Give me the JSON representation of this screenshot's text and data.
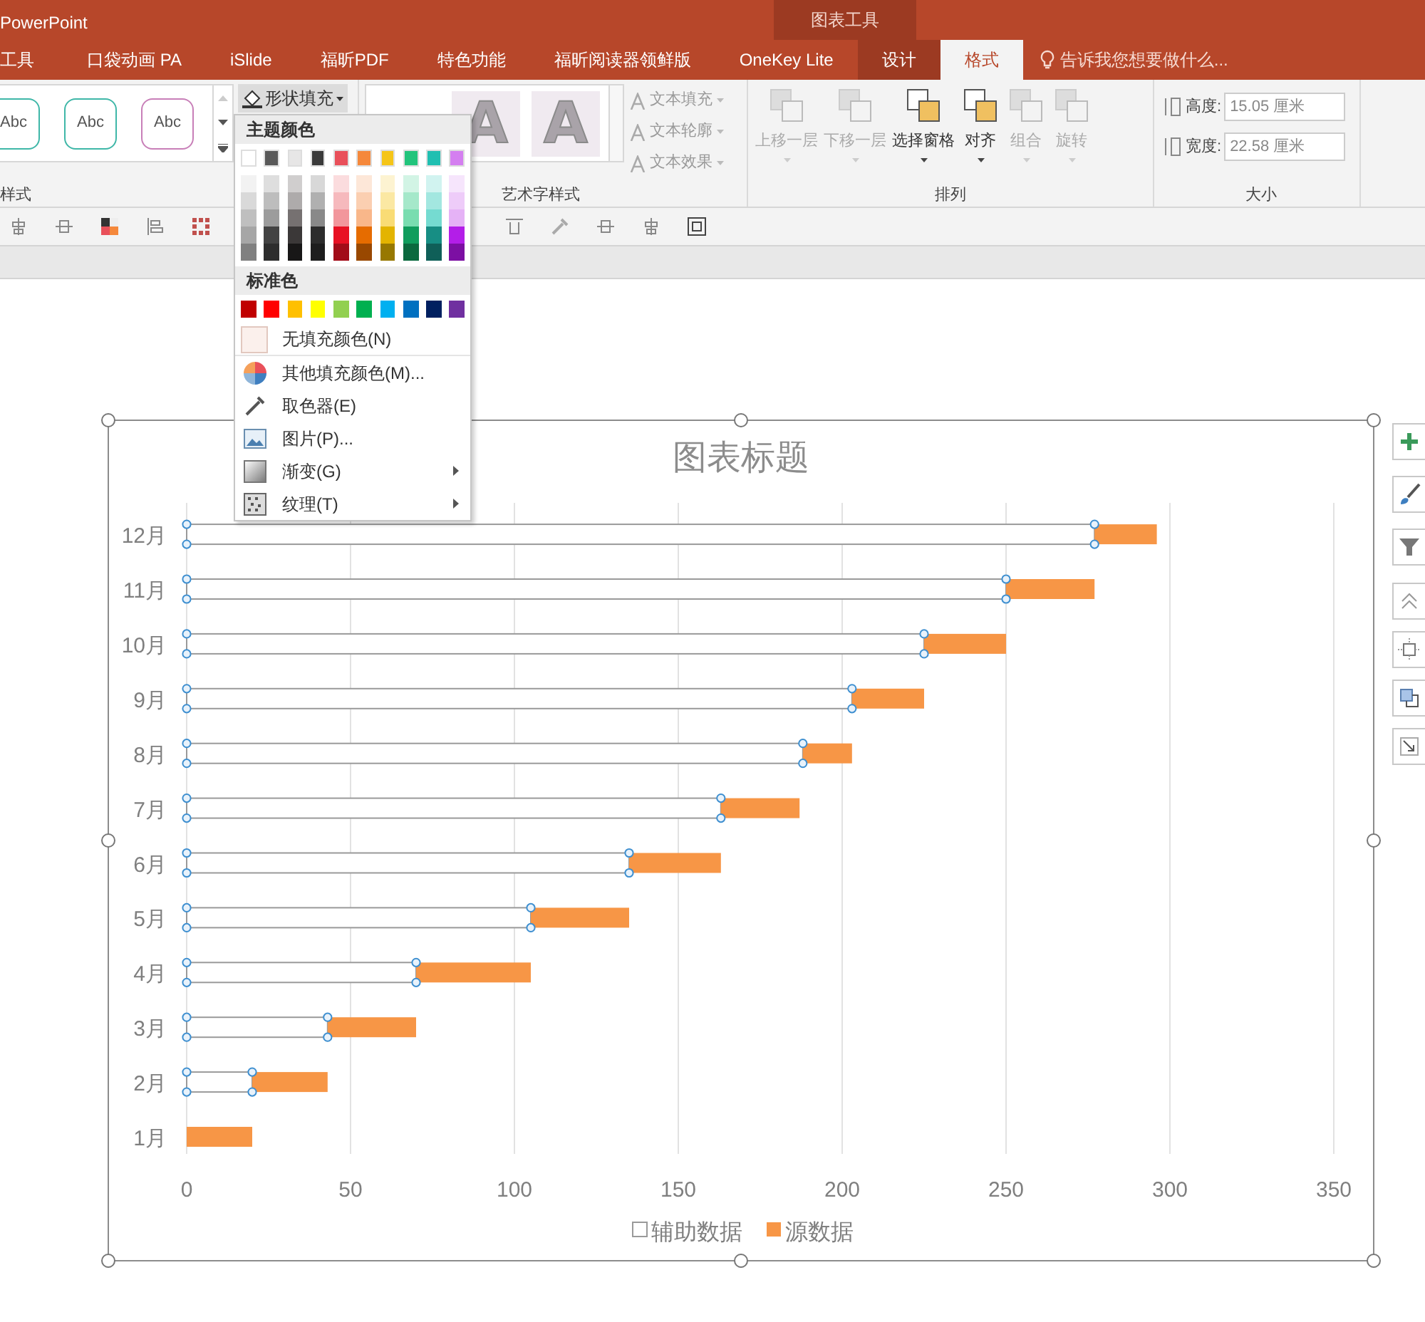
{
  "app_title": "PowerPoint",
  "context_tab_group": "图表工具",
  "tabs": [
    {
      "label": "工具",
      "selected": false
    },
    {
      "label": "口袋动画 PA",
      "selected": false
    },
    {
      "label": "iSlide",
      "selected": false
    },
    {
      "label": "福昕PDF",
      "selected": false
    },
    {
      "label": "特色功能",
      "selected": false
    },
    {
      "label": "福昕阅读器领鲜版",
      "selected": false
    },
    {
      "label": "OneKey Lite",
      "selected": false
    },
    {
      "label": "设计",
      "selected": false,
      "context": true
    },
    {
      "label": "格式",
      "selected": true,
      "context": true
    }
  ],
  "tell_me": {
    "placeholder": "告诉我您想要做什么..."
  },
  "ribbon": {
    "shape_styles": {
      "label": "样式",
      "samples": [
        {
          "text": "Abc",
          "color": "#3fb7a8"
        },
        {
          "text": "Abc",
          "color": "#3fb7a8"
        },
        {
          "text": "Abc",
          "color": "#c87fb8"
        }
      ],
      "shape_fill": "形状填充"
    },
    "wordart_styles": {
      "label": "艺术字样式",
      "samples": [
        "A",
        "A"
      ],
      "commands": [
        "文本填充",
        "文本轮廓",
        "文本效果"
      ]
    },
    "arrange": {
      "label": "排列",
      "commands": [
        {
          "label": "上移一层",
          "disabled": true
        },
        {
          "label": "下移一层",
          "disabled": true
        },
        {
          "label": "选择窗格",
          "disabled": false
        },
        {
          "label": "对齐",
          "disabled": false
        },
        {
          "label": "组合",
          "disabled": true
        },
        {
          "label": "旋转",
          "disabled": true
        }
      ]
    },
    "size": {
      "label": "大小",
      "height_label": "高度:",
      "height": "15.05 厘米",
      "width_label": "宽度:",
      "width": "22.58 厘米"
    }
  },
  "fill_menu": {
    "theme_header": "主题颜色",
    "theme_rows": [
      {
        "swatches": [
          {
            "color": "#ffffff"
          },
          {
            "color": "#595959"
          },
          {
            "color": "#e7e6e6"
          },
          {
            "color": "#3a3a3a"
          },
          {
            "color": "#e9505a"
          },
          {
            "color": "#f5883b"
          },
          {
            "color": "#f5c518"
          },
          {
            "color": "#22c47c"
          },
          {
            "color": "#20bfb1"
          },
          {
            "color": "#d47ff0"
          }
        ]
      },
      {
        "swatches": [
          {
            "color": "#f2f2f2"
          },
          {
            "color": "#dedede"
          },
          {
            "color": "#d0cece"
          },
          {
            "color": "#d8d8d8"
          },
          {
            "color": "#fbdcde"
          },
          {
            "color": "#fde7d8"
          },
          {
            "color": "#fdf3d1"
          },
          {
            "color": "#d2f4e5"
          },
          {
            "color": "#d1f3f0"
          },
          {
            "color": "#f6e5fc"
          }
        ]
      },
      {
        "swatches": [
          {
            "color": "#d9d9d9"
          },
          {
            "color": "#bdbdbd"
          },
          {
            "color": "#aeabab"
          },
          {
            "color": "#b0b0b0"
          },
          {
            "color": "#f6b9bd"
          },
          {
            "color": "#fbcfb1"
          },
          {
            "color": "#fbe8a3"
          },
          {
            "color": "#a5e8ca"
          },
          {
            "color": "#a3e7e0"
          },
          {
            "color": "#eeccf9"
          }
        ]
      },
      {
        "swatches": [
          {
            "color": "#bfbfbf"
          },
          {
            "color": "#9c9c9c"
          },
          {
            "color": "#767171"
          },
          {
            "color": "#898989"
          },
          {
            "color": "#f2969c"
          },
          {
            "color": "#f9b78a"
          },
          {
            "color": "#f9dc75"
          },
          {
            "color": "#79ddb0"
          },
          {
            "color": "#75dbd1"
          },
          {
            "color": "#e5b2f6"
          }
        ]
      },
      {
        "swatches": [
          {
            "color": "#a6a6a6"
          },
          {
            "color": "#434343"
          },
          {
            "color": "#3b3838"
          },
          {
            "color": "#2c2c2c"
          },
          {
            "color": "#e81123"
          },
          {
            "color": "#e66c00"
          },
          {
            "color": "#e3b400"
          },
          {
            "color": "#109d5d"
          },
          {
            "color": "#178e84"
          },
          {
            "color": "#b31ee8"
          }
        ]
      },
      {
        "swatches": [
          {
            "color": "#808080"
          },
          {
            "color": "#2d2d2d"
          },
          {
            "color": "#181717"
          },
          {
            "color": "#1d1d1d"
          },
          {
            "color": "#a20c18"
          },
          {
            "color": "#994800"
          },
          {
            "color": "#977800"
          },
          {
            "color": "#0b693e"
          },
          {
            "color": "#0f5f58"
          },
          {
            "color": "#7c0fa3"
          }
        ]
      }
    ],
    "standard_header": "标准色",
    "standard": [
      {
        "color": "#c00000"
      },
      {
        "color": "#ff0000"
      },
      {
        "color": "#ffc000"
      },
      {
        "color": "#ffff00"
      },
      {
        "color": "#92d050"
      },
      {
        "color": "#00b050"
      },
      {
        "color": "#00b0f0"
      },
      {
        "color": "#0070c0"
      },
      {
        "color": "#002060"
      },
      {
        "color": "#7030a0"
      }
    ],
    "items": [
      {
        "kind": "no-fill",
        "label": "无填充颜色(N)",
        "submenu": false
      },
      {
        "kind": "more-colors",
        "label": "其他填充颜色(M)...",
        "submenu": false
      },
      {
        "kind": "eyedropper",
        "label": "取色器(E)",
        "submenu": false
      },
      {
        "kind": "picture",
        "label": "图片(P)...",
        "submenu": false
      },
      {
        "kind": "gradient",
        "label": "渐变(G)",
        "submenu": true
      },
      {
        "kind": "texture",
        "label": "纹理(T)",
        "submenu": true
      }
    ]
  },
  "chart": {
    "chart_data": {
      "type": "bar",
      "orientation": "horizontal",
      "stacked": true,
      "title": "图表标题",
      "grid": true,
      "legend": "bottom",
      "categories": [
        "12月",
        "11月",
        "10月",
        "9月",
        "8月",
        "7月",
        "6月",
        "5月",
        "4月",
        "3月",
        "2月",
        "1月"
      ],
      "series": [
        {
          "name": "辅助数据",
          "color": "#ffffff",
          "values": [
            277,
            250,
            225,
            203,
            188,
            163,
            135,
            105,
            70,
            43,
            20,
            0
          ]
        },
        {
          "name": "源数据",
          "color": "#f79646",
          "values": [
            19,
            27,
            25,
            22,
            15,
            24,
            28,
            30,
            35,
            27,
            23,
            20
          ]
        }
      ],
      "xlim": [
        0,
        350
      ],
      "xticks": [
        0,
        50,
        100,
        150,
        200,
        250,
        300,
        350
      ]
    },
    "series_states": [
      {
        "selected": true
      },
      {
        "selected": false
      }
    ]
  }
}
